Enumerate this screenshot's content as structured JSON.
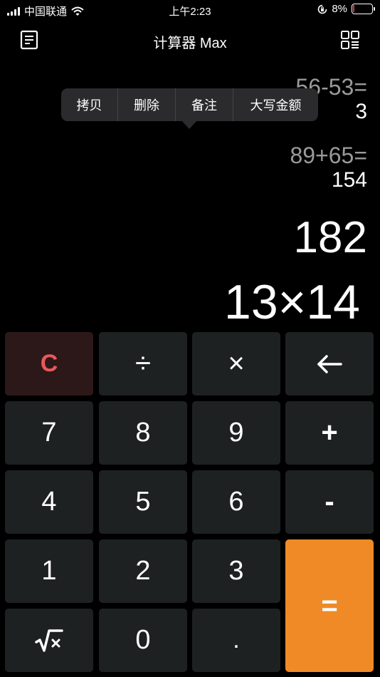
{
  "status_bar": {
    "carrier": "中国联通",
    "time": "上午2:23",
    "battery_percent": "8%",
    "battery_level": 0.08,
    "battery_color": "#e33333"
  },
  "header": {
    "title": "计算器 Max",
    "left_icon": "document-list-icon",
    "right_icon": "grid-menu-icon"
  },
  "context_menu": {
    "items": [
      "拷贝",
      "删除",
      "备注",
      "大写金额"
    ]
  },
  "history": [
    {
      "expression": "56-53=",
      "result": "3"
    },
    {
      "expression": "89+65=",
      "result": "154"
    }
  ],
  "display": {
    "result": "182",
    "expression": "13×14"
  },
  "keypad": {
    "clear": "C",
    "divide": "÷",
    "multiply": "×",
    "backspace_icon": "left-arrow-icon",
    "seven": "7",
    "eight": "8",
    "nine": "9",
    "plus": "+",
    "four": "4",
    "five": "5",
    "six": "6",
    "minus": "-",
    "one": "1",
    "two": "2",
    "three": "3",
    "equals": "=",
    "sqrt_icon": "square-root-icon",
    "zero": "0",
    "dot": "."
  },
  "colors": {
    "accent_equals": "#f08a26",
    "clear_text": "#e8595c",
    "clear_bg": "#2d1819",
    "key_bg": "#1e2122"
  }
}
